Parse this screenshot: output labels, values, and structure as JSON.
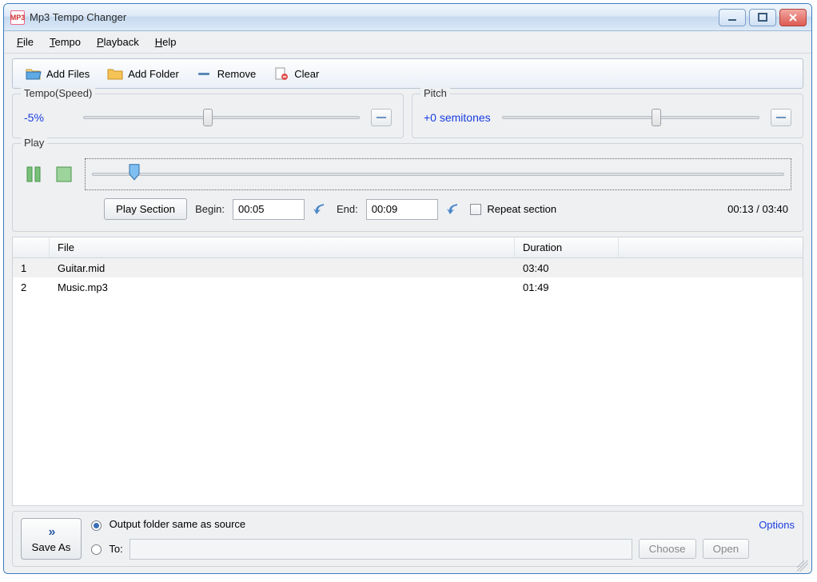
{
  "window": {
    "title": "Mp3 Tempo Changer"
  },
  "menu": {
    "file": "File",
    "tempo": "Tempo",
    "playback": "Playback",
    "help": "Help"
  },
  "toolbar": {
    "add_files": "Add Files",
    "add_folder": "Add Folder",
    "remove": "Remove",
    "clear": "Clear"
  },
  "tempo": {
    "legend": "Tempo(Speed)",
    "value": "-5%",
    "slider_pos_pct": 45
  },
  "pitch": {
    "legend": "Pitch",
    "value": "+0 semitones",
    "slider_pos_pct": 60
  },
  "play": {
    "legend": "Play",
    "play_section_label": "Play Section",
    "begin_label": "Begin:",
    "begin_value": "00:05",
    "end_label": "End:",
    "end_value": "00:09",
    "repeat_label": "Repeat section",
    "repeat_checked": false,
    "time_status": "00:13 / 03:40",
    "progress_pos_pct": 6
  },
  "filelist": {
    "columns": {
      "file": "File",
      "duration": "Duration"
    },
    "rows": [
      {
        "n": "1",
        "file": "Guitar.mid",
        "duration": "03:40",
        "selected": true
      },
      {
        "n": "2",
        "file": "Music.mp3",
        "duration": "01:49",
        "selected": false
      }
    ]
  },
  "output": {
    "save_as": "Save As",
    "same_as_source_label": "Output folder same as source",
    "to_label": "To:",
    "to_path": "",
    "choose": "Choose",
    "open": "Open",
    "options": "Options",
    "selected": "same"
  }
}
